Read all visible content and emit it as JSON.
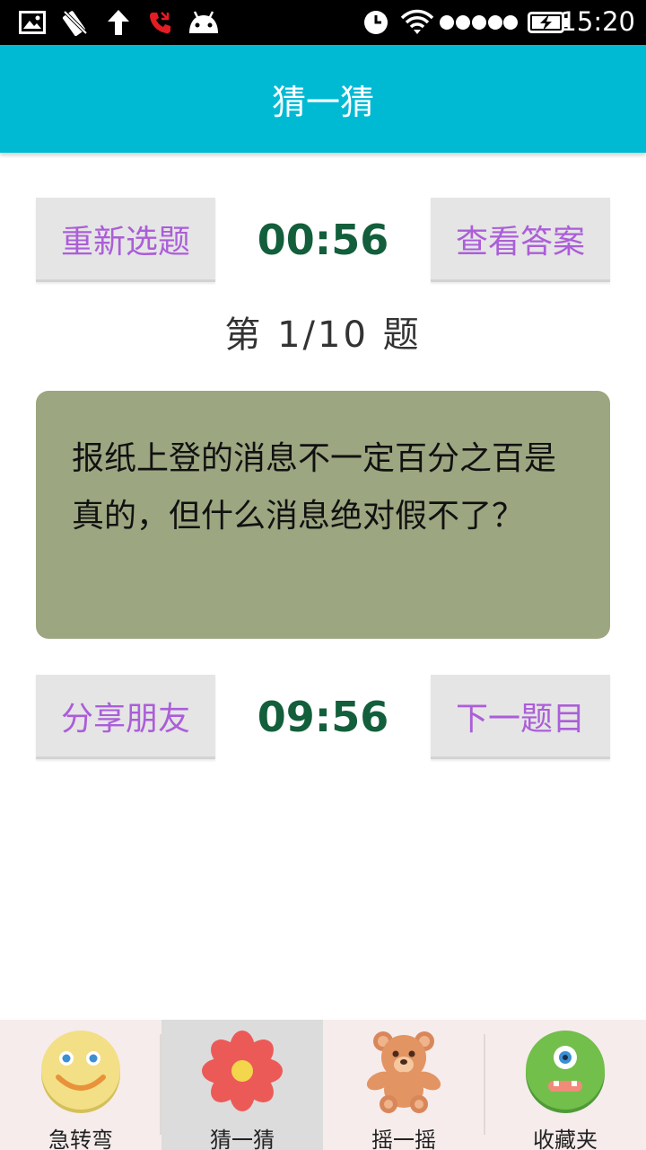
{
  "status_bar": {
    "time": "15:20",
    "icons": [
      "image-icon",
      "no-signal-icon",
      "upload-arrow-icon",
      "missed-call-icon",
      "android-icon",
      "clock-icon",
      "wifi-icon",
      "signal-dots-icon",
      "battery-charging-icon"
    ]
  },
  "app_bar": {
    "title": "猜一猜"
  },
  "top_controls": {
    "reselect_label": "重新选题",
    "countdown": "00:56",
    "show_answer_label": "查看答案"
  },
  "question": {
    "counter": "第 1/10 题",
    "text": "报纸上登的消息不一定百分之百是真的，但什么消息绝对假不了？"
  },
  "bottom_controls": {
    "share_label": "分享朋友",
    "total_timer": "09:56",
    "next_label": "下一题目"
  },
  "bottom_nav": {
    "tabs": [
      {
        "label": "急转弯",
        "icon": "smiley-icon",
        "active": false
      },
      {
        "label": "猜一猜",
        "icon": "flower-icon",
        "active": true
      },
      {
        "label": "摇一摇",
        "icon": "teddy-bear-icon",
        "active": false
      },
      {
        "label": "收藏夹",
        "icon": "monster-icon",
        "active": false
      }
    ]
  },
  "colors": {
    "app_bar": "#00bad4",
    "button_text": "#ab5ed8",
    "timer_text": "#135e3b",
    "card_background": "#9ca680"
  }
}
